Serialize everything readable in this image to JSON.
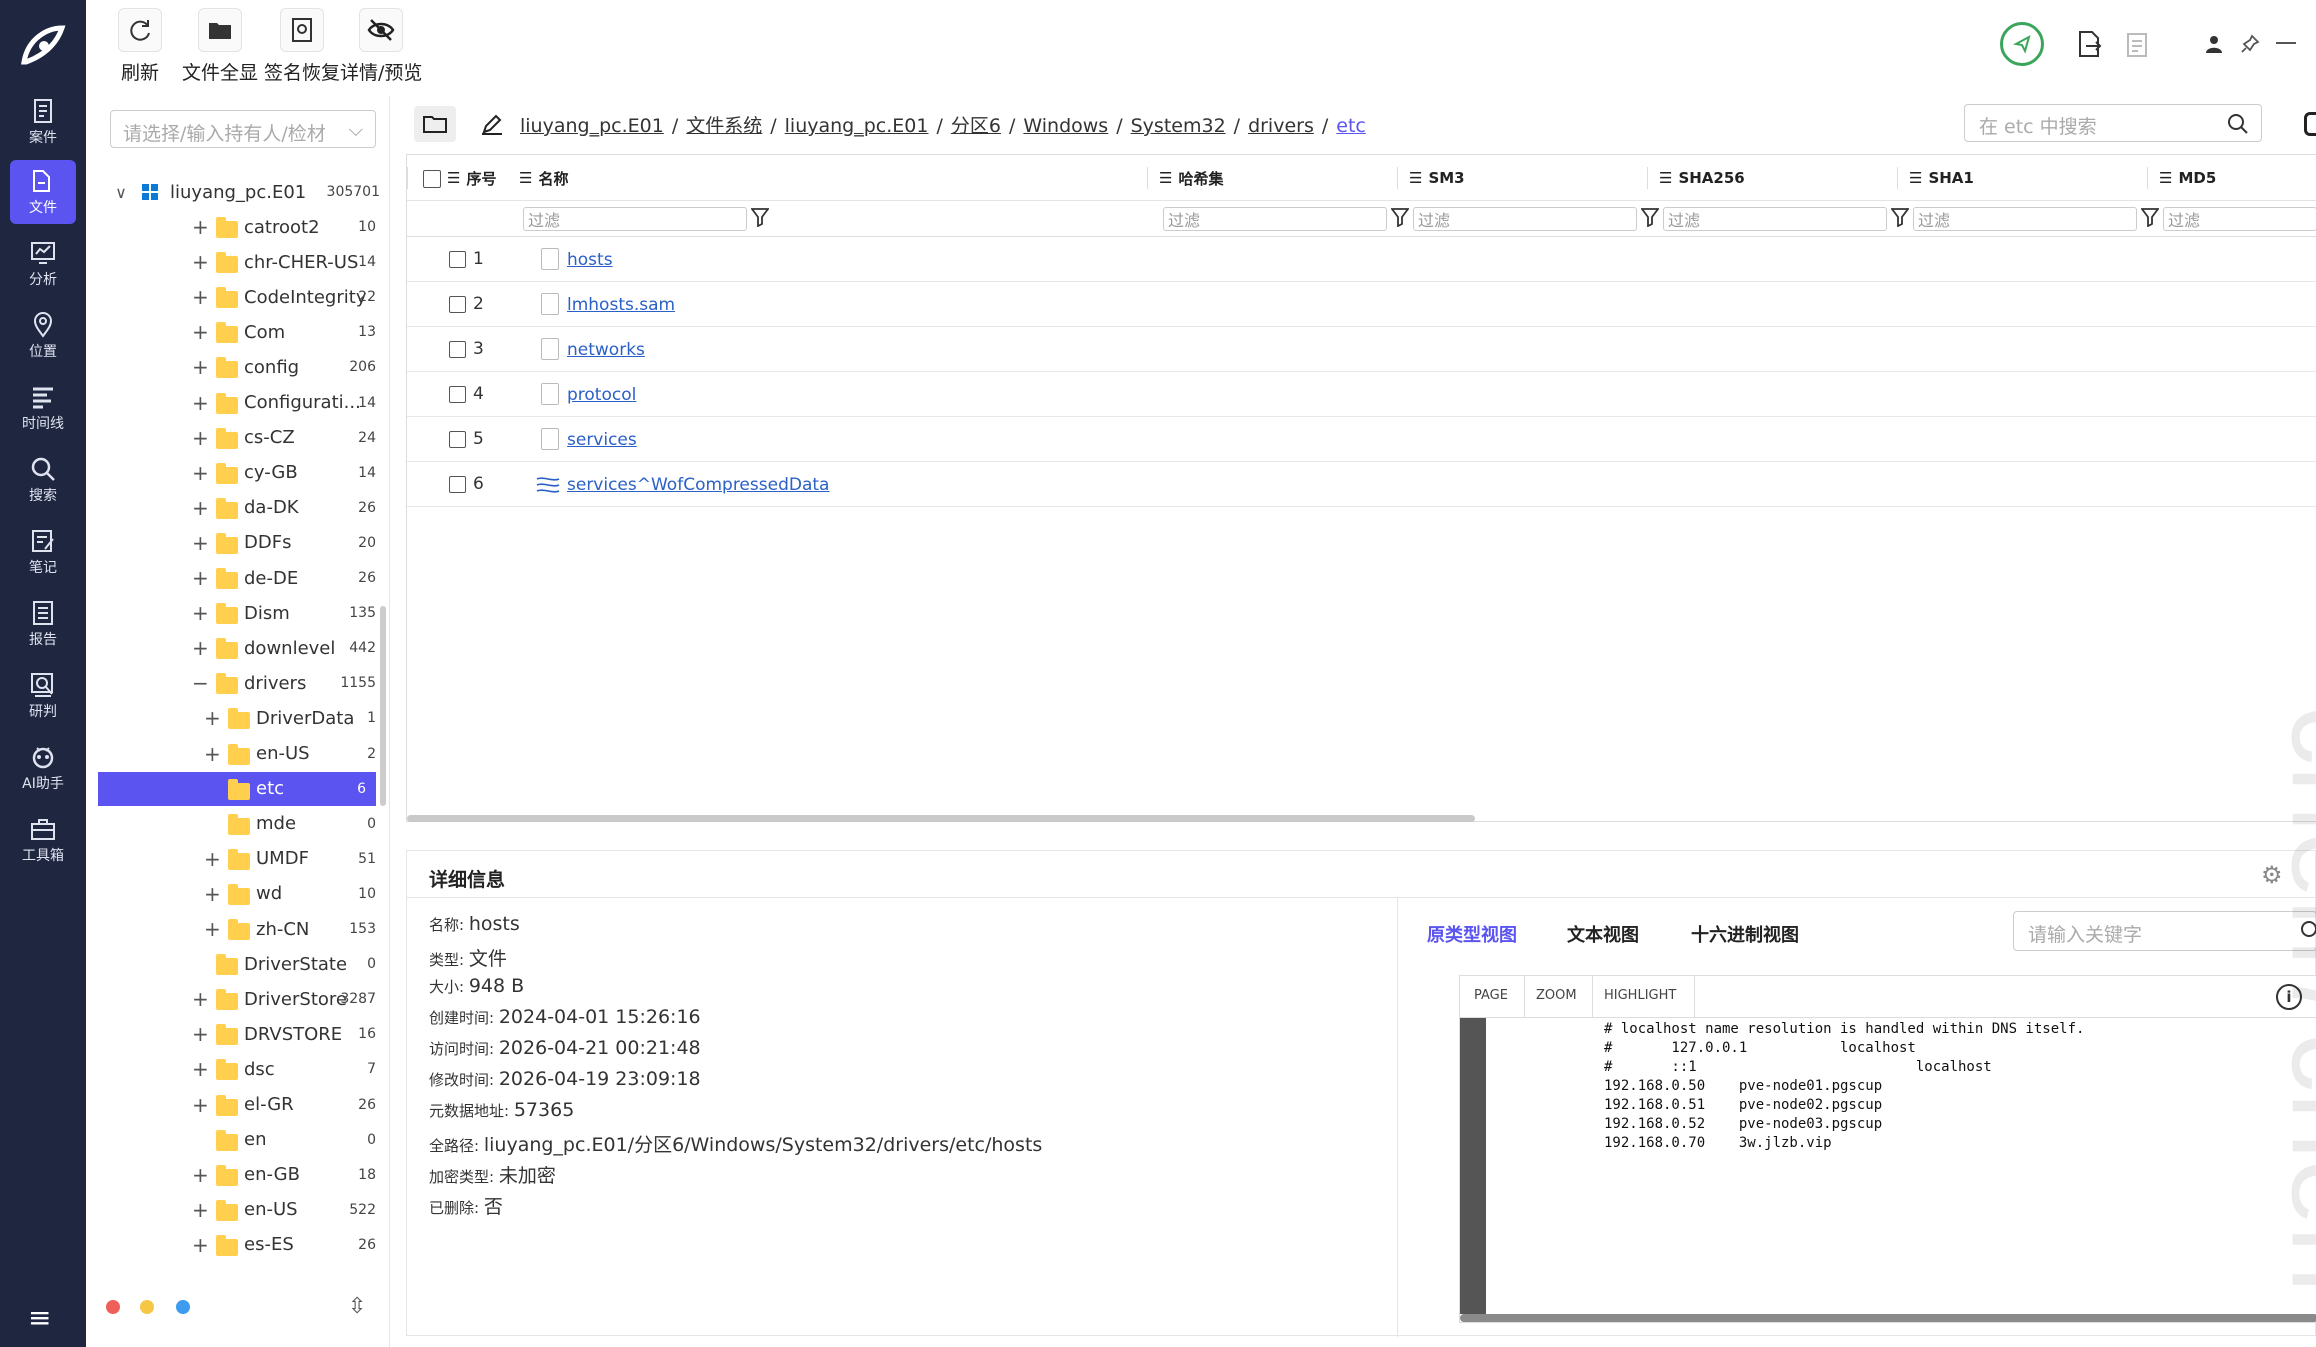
{
  "rail": [
    {
      "label": "案件",
      "icon": "case-icon"
    },
    {
      "label": "文件",
      "icon": "file-icon",
      "active": true
    },
    {
      "label": "分析",
      "icon": "analysis-icon"
    },
    {
      "label": "位置",
      "icon": "location-icon"
    },
    {
      "label": "时间线",
      "icon": "timeline-icon"
    },
    {
      "label": "搜索",
      "icon": "search-icon"
    },
    {
      "label": "笔记",
      "icon": "note-icon"
    },
    {
      "label": "报告",
      "icon": "report-icon"
    },
    {
      "label": "研判",
      "icon": "judge-icon"
    },
    {
      "label": "AI助手",
      "icon": "ai-icon"
    },
    {
      "label": "工具箱",
      "icon": "toolbox-icon"
    }
  ],
  "toolbar": {
    "refresh": "刷新",
    "all_files": "文件全显",
    "signature": "签名恢复",
    "detail": "详情/预览"
  },
  "tree": {
    "search_placeholder": "请选择/输入持有人/检材",
    "root_label": "liuyang_pc.E01",
    "root_count": "305701",
    "items": [
      {
        "label": "catroot2",
        "count": "10",
        "toggle": "+"
      },
      {
        "label": "chr-CHER-US",
        "count": "14",
        "toggle": "+"
      },
      {
        "label": "CodeIntegrity",
        "count": "22",
        "toggle": "+"
      },
      {
        "label": "Com",
        "count": "13",
        "toggle": "+"
      },
      {
        "label": "config",
        "count": "206",
        "toggle": "+"
      },
      {
        "label": "Configurati...",
        "count": "14",
        "toggle": "+"
      },
      {
        "label": "cs-CZ",
        "count": "24",
        "toggle": "+"
      },
      {
        "label": "cy-GB",
        "count": "14",
        "toggle": "+"
      },
      {
        "label": "da-DK",
        "count": "26",
        "toggle": "+"
      },
      {
        "label": "DDFs",
        "count": "20",
        "toggle": "+"
      },
      {
        "label": "de-DE",
        "count": "26",
        "toggle": "+"
      },
      {
        "label": "Dism",
        "count": "135",
        "toggle": "+"
      },
      {
        "label": "downlevel",
        "count": "442",
        "toggle": "+"
      },
      {
        "label": "drivers",
        "count": "1155",
        "toggle": "−"
      },
      {
        "label": "DriverData",
        "count": "1",
        "toggle": "+",
        "indent": 1
      },
      {
        "label": "en-US",
        "count": "2",
        "toggle": "+",
        "indent": 1
      },
      {
        "label": "etc",
        "count": "6",
        "toggle": "",
        "indent": 1,
        "selected": true
      },
      {
        "label": "mde",
        "count": "0",
        "toggle": "",
        "indent": 1
      },
      {
        "label": "UMDF",
        "count": "51",
        "toggle": "+",
        "indent": 1
      },
      {
        "label": "wd",
        "count": "10",
        "toggle": "+",
        "indent": 1
      },
      {
        "label": "zh-CN",
        "count": "153",
        "toggle": "+",
        "indent": 1
      },
      {
        "label": "DriverState",
        "count": "0",
        "toggle": ""
      },
      {
        "label": "DriverStore",
        "count": "3287",
        "toggle": "+"
      },
      {
        "label": "DRVSTORE",
        "count": "16",
        "toggle": "+"
      },
      {
        "label": "dsc",
        "count": "7",
        "toggle": "+"
      },
      {
        "label": "el-GR",
        "count": "26",
        "toggle": "+"
      },
      {
        "label": "en",
        "count": "0",
        "toggle": ""
      },
      {
        "label": "en-GB",
        "count": "18",
        "toggle": "+"
      },
      {
        "label": "en-US",
        "count": "522",
        "toggle": "+"
      },
      {
        "label": "es-ES",
        "count": "26",
        "toggle": "+"
      }
    ]
  },
  "breadcrumb": [
    "liuyang_pc.E01",
    "文件系统",
    "liuyang_pc.E01",
    "分区6",
    "Windows",
    "System32",
    "drivers",
    "etc"
  ],
  "breadcrumb_sep": "/",
  "search_placeholder": "在 etc 中搜索",
  "grid": {
    "columns": [
      "序号",
      "名称",
      "哈希集",
      "SM3",
      "SHA256",
      "SHA1",
      "MD5"
    ],
    "filter_placeholder": "过滤",
    "rows": [
      {
        "num": "1",
        "name": "hosts"
      },
      {
        "num": "2",
        "name": "lmhosts.sam"
      },
      {
        "num": "3",
        "name": "networks"
      },
      {
        "num": "4",
        "name": "protocol"
      },
      {
        "num": "5",
        "name": "services"
      },
      {
        "num": "6",
        "name": "services^WofCompressedData"
      }
    ]
  },
  "details": {
    "title": "详细信息",
    "fields": [
      {
        "k": "名称:",
        "v": "hosts"
      },
      {
        "k": "类型:",
        "v": "文件"
      },
      {
        "k": "大小:",
        "v": "948 B"
      },
      {
        "k": "创建时间:",
        "v": "2024-04-01 15:26:16"
      },
      {
        "k": "访问时间:",
        "v": "2026-04-21 00:21:48"
      },
      {
        "k": "修改时间:",
        "v": "2026-04-19 23:09:18"
      },
      {
        "k": "元数据地址:",
        "v": "57365"
      },
      {
        "k": "全路径:",
        "v": "liuyang_pc.E01/分区6/Windows/System32/drivers/etc/hosts"
      },
      {
        "k": "加密类型:",
        "v": "未加密"
      },
      {
        "k": "已删除:",
        "v": "否"
      }
    ],
    "view_tabs": [
      "原类型视图",
      "文本视图",
      "十六进制视图"
    ],
    "keyword_placeholder": "请输入关键字",
    "viewer_tabs": [
      "PAGE",
      "ZOOM",
      "HIGHLIGHT"
    ],
    "content": "# localhost name resolution is handled within DNS itself.\n#       127.0.0.1           localhost\n#       ::1                          localhost\n192.168.0.50    pve-node01.pgscup\n192.168.0.51    pve-node02.pgscup\n192.168.0.52    pve-node03.pgscup\n192.168.0.70    3w.jlzb.vip"
  },
  "watermark": "chen7chen",
  "colors": {
    "rail_bg": "#1f2640",
    "accent": "#5b54f0",
    "link": "#2b60c7",
    "folder": "#ffcf4d"
  }
}
